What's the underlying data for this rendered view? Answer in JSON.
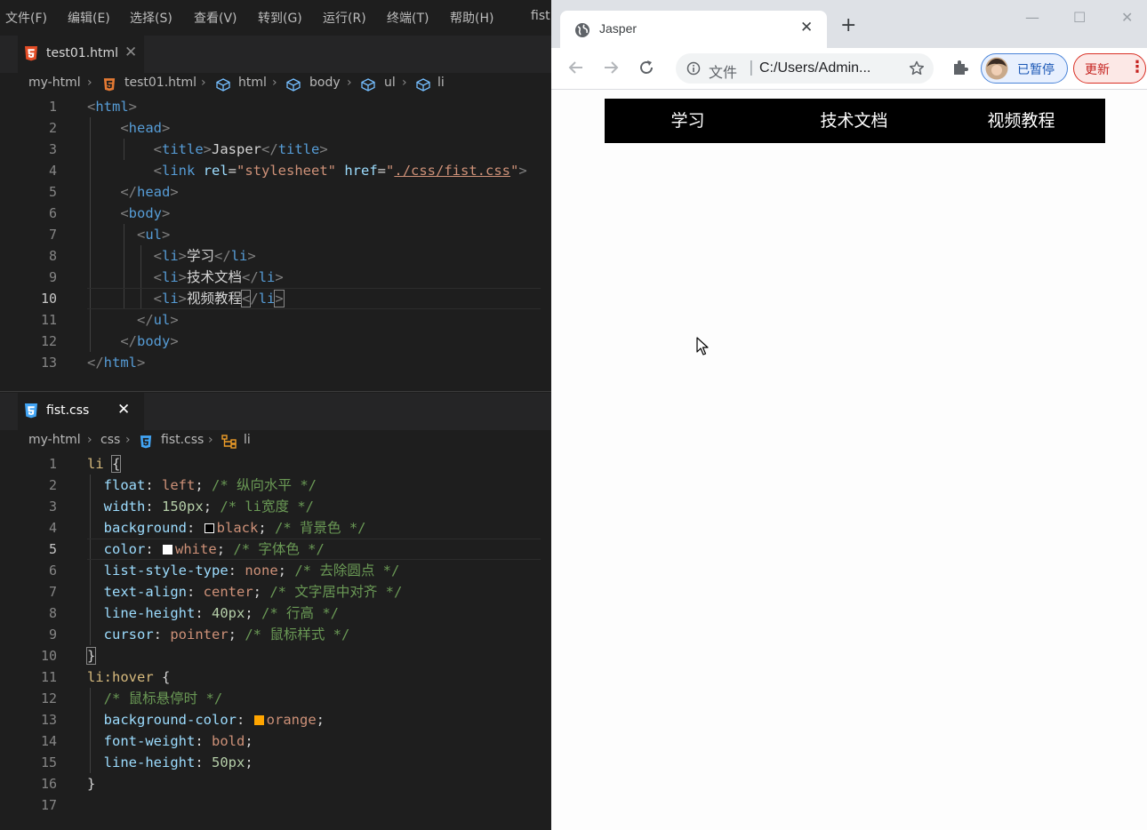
{
  "menu": [
    "文件(F)",
    "编辑(E)",
    "选择(S)",
    "查看(V)",
    "转到(G)",
    "运行(R)",
    "终端(T)",
    "帮助(H)",
    "fist."
  ],
  "html_pane": {
    "tab": "test01.html",
    "breadcrumb": [
      "my-html",
      "test01.html",
      "html",
      "body",
      "ul",
      "li"
    ],
    "current_line": 10,
    "line_numbers": [
      "1",
      "2",
      "3",
      "4",
      "5",
      "6",
      "7",
      "8",
      "9",
      "10",
      "11",
      "12",
      "13"
    ]
  },
  "css_pane": {
    "tab": "fist.css",
    "breadcrumb": [
      "my-html",
      "css",
      "fist.css",
      "li"
    ],
    "current_line": 5,
    "line_numbers": [
      "1",
      "2",
      "3",
      "4",
      "5",
      "6",
      "7",
      "8",
      "9",
      "10",
      "11",
      "12",
      "13",
      "14",
      "15",
      "16",
      "17"
    ]
  },
  "colors": {
    "swatch_black": "#000000",
    "swatch_white": "#ffffff",
    "swatch_orange": "#ffa500"
  },
  "browser": {
    "tab_title": "Jasper",
    "omnibox_label": "文件",
    "url": "C:/Users/Admin...",
    "profile": "已暂停",
    "update": "更新"
  },
  "page": {
    "nav_items": [
      "学习",
      "技术文档",
      "视频教程"
    ],
    "nav_background": "#000000",
    "nav_text_color": "#ffffff"
  }
}
